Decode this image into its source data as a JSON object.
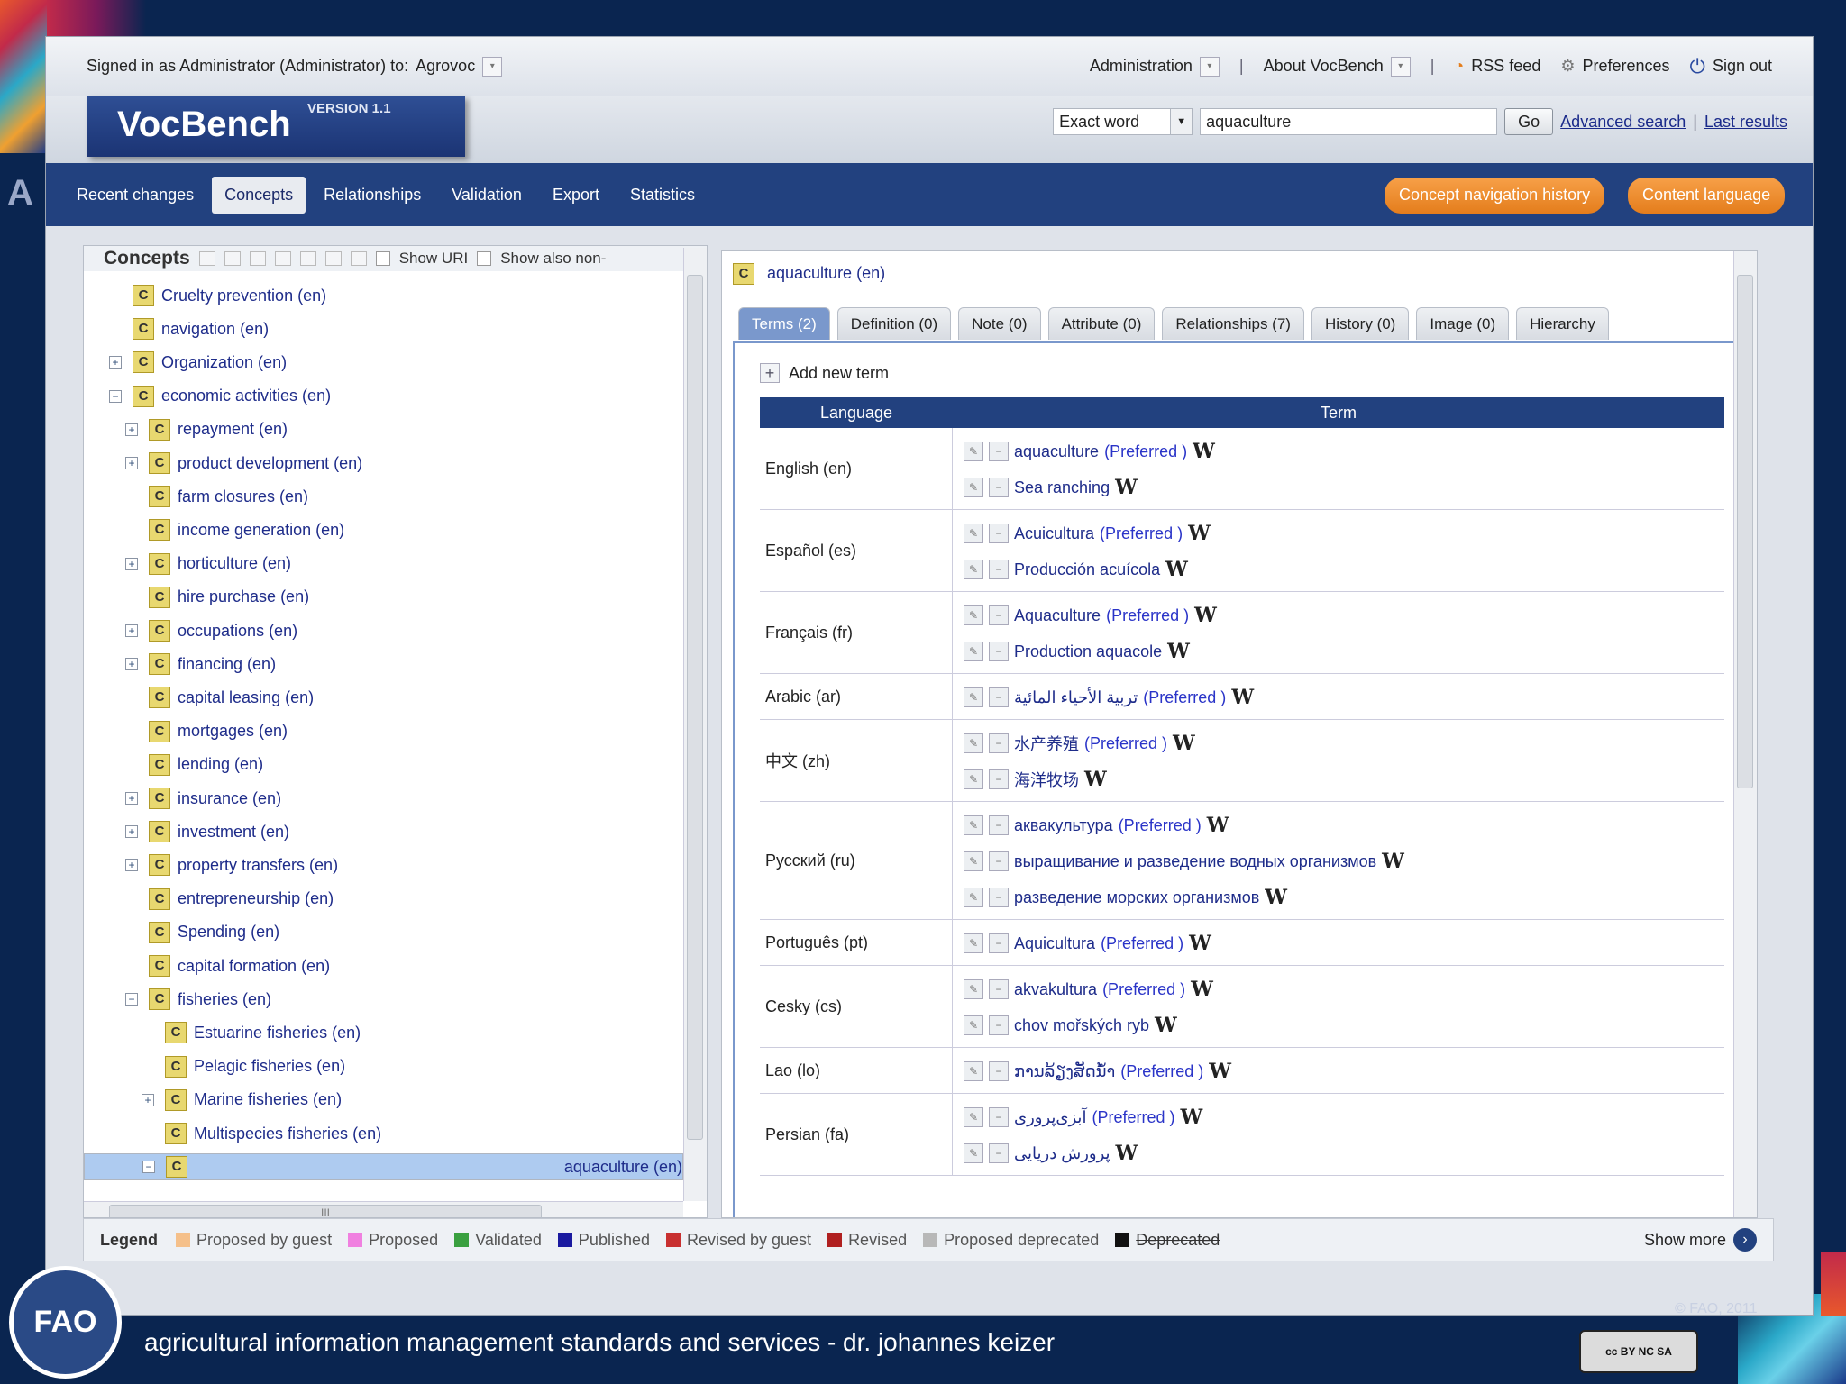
{
  "topbar": {
    "signed_in": "Signed in as Administrator (Administrator) to:",
    "project": "Agrovoc",
    "administration": "Administration",
    "about": "About VocBench",
    "rss": "RSS feed",
    "preferences": "Preferences",
    "signout": "Sign out"
  },
  "header": {
    "app_name": "VocBench",
    "version": "VERSION 1.1",
    "search_mode": "Exact word",
    "search_value": "aquaculture",
    "go": "Go",
    "advanced": "Advanced search",
    "last_results": "Last results"
  },
  "nav": {
    "tabs": [
      "Recent changes",
      "Concepts",
      "Relationships",
      "Validation",
      "Export",
      "Statistics"
    ],
    "active": "Concepts",
    "history_btn": "Concept navigation history",
    "language_btn": "Content language"
  },
  "concepts": {
    "title": "Concepts",
    "show_uri": "Show URI",
    "show_also": "Show also non-",
    "tree": [
      {
        "label": "Cruelty prevention (en)",
        "level": 0,
        "toggle": ""
      },
      {
        "label": "navigation (en)",
        "level": 0,
        "toggle": ""
      },
      {
        "label": "Organization (en)",
        "level": 0,
        "toggle": "+"
      },
      {
        "label": "economic activities (en)",
        "level": 0,
        "toggle": "-"
      },
      {
        "label": "repayment (en)",
        "level": 1,
        "toggle": "+"
      },
      {
        "label": "product development (en)",
        "level": 1,
        "toggle": "+"
      },
      {
        "label": "farm closures (en)",
        "level": 1,
        "toggle": ""
      },
      {
        "label": "income generation (en)",
        "level": 1,
        "toggle": ""
      },
      {
        "label": "horticulture (en)",
        "level": 1,
        "toggle": "+"
      },
      {
        "label": "hire purchase (en)",
        "level": 1,
        "toggle": ""
      },
      {
        "label": "occupations (en)",
        "level": 1,
        "toggle": "+"
      },
      {
        "label": "financing (en)",
        "level": 1,
        "toggle": "+"
      },
      {
        "label": "capital leasing (en)",
        "level": 1,
        "toggle": ""
      },
      {
        "label": "mortgages (en)",
        "level": 1,
        "toggle": ""
      },
      {
        "label": "lending (en)",
        "level": 1,
        "toggle": ""
      },
      {
        "label": "insurance (en)",
        "level": 1,
        "toggle": "+"
      },
      {
        "label": "investment (en)",
        "level": 1,
        "toggle": "+"
      },
      {
        "label": "property transfers (en)",
        "level": 1,
        "toggle": "+"
      },
      {
        "label": "entrepreneurship (en)",
        "level": 1,
        "toggle": ""
      },
      {
        "label": "Spending (en)",
        "level": 1,
        "toggle": ""
      },
      {
        "label": "capital formation (en)",
        "level": 1,
        "toggle": ""
      },
      {
        "label": "fisheries (en)",
        "level": 1,
        "toggle": "-"
      },
      {
        "label": "Estuarine fisheries (en)",
        "level": 2,
        "toggle": ""
      },
      {
        "label": "Pelagic fisheries (en)",
        "level": 2,
        "toggle": ""
      },
      {
        "label": "Marine fisheries (en)",
        "level": 2,
        "toggle": "+"
      },
      {
        "label": "Multispecies fisheries (en)",
        "level": 2,
        "toggle": ""
      },
      {
        "label": "aquaculture (en)",
        "level": 2,
        "toggle": "-",
        "selected": true
      }
    ]
  },
  "detail": {
    "title": "aquaculture (en)",
    "tabs": [
      "Terms (2)",
      "Definition (0)",
      "Note (0)",
      "Attribute (0)",
      "Relationships (7)",
      "History (0)",
      "Image (0)",
      "Hierarchy"
    ],
    "active_tab": "Terms (2)",
    "add_term": "Add new term",
    "col_language": "Language",
    "col_term": "Term",
    "preferred": "(Preferred )",
    "languages": [
      {
        "name": "English (en)",
        "terms": [
          {
            "t": "aquaculture",
            "pref": true
          },
          {
            "t": "Sea ranching",
            "pref": false
          }
        ]
      },
      {
        "name": "Español (es)",
        "terms": [
          {
            "t": "Acuicultura",
            "pref": true
          },
          {
            "t": "Producción acuícola",
            "pref": false
          }
        ]
      },
      {
        "name": "Français (fr)",
        "terms": [
          {
            "t": "Aquaculture",
            "pref": true
          },
          {
            "t": "Production aquacole",
            "pref": false
          }
        ]
      },
      {
        "name": "Arabic (ar)",
        "terms": [
          {
            "t": "تربية الأحياء المائية",
            "pref": true
          }
        ]
      },
      {
        "name": "中文 (zh)",
        "terms": [
          {
            "t": "水产养殖",
            "pref": true
          },
          {
            "t": "海洋牧场",
            "pref": false
          }
        ]
      },
      {
        "name": "Русский (ru)",
        "terms": [
          {
            "t": "аквакультура",
            "pref": true
          },
          {
            "t": "выращивание и разведение водных организмов",
            "pref": false
          },
          {
            "t": "разведение морских организмов",
            "pref": false
          }
        ]
      },
      {
        "name": "Português (pt)",
        "terms": [
          {
            "t": "Aquicultura",
            "pref": true
          }
        ]
      },
      {
        "name": "Cesky (cs)",
        "terms": [
          {
            "t": "akvakultura",
            "pref": true
          },
          {
            "t": "chov mořských ryb",
            "pref": false
          }
        ]
      },
      {
        "name": "Lao (lo)",
        "terms": [
          {
            "t": "ການລ້ຽງສັດນ້ຳ",
            "pref": true
          }
        ]
      },
      {
        "name": "Persian (fa)",
        "terms": [
          {
            "t": "آبزی‌پروری",
            "pref": true
          },
          {
            "t": "پرورش دریایی",
            "pref": false
          }
        ]
      }
    ]
  },
  "legend": {
    "title": "Legend",
    "items": [
      {
        "label": "Proposed by guest",
        "color": "#f5c08a"
      },
      {
        "label": "Proposed",
        "color": "#f080e0"
      },
      {
        "label": "Validated",
        "color": "#3aa040"
      },
      {
        "label": "Published",
        "color": "#1a1aa0"
      },
      {
        "label": "Revised by guest",
        "color": "#c83030"
      },
      {
        "label": "Revised",
        "color": "#b02020"
      },
      {
        "label": "Proposed deprecated",
        "color": "#b8b8b8"
      },
      {
        "label": "Deprecated",
        "color": "#111111"
      }
    ],
    "show_more": "Show more"
  },
  "footer": {
    "text": "agricultural information management standards and services  -   dr.   johannes keizer",
    "copyright": "© FAO, 2011",
    "fao": "FAO"
  },
  "colors": {
    "nav": "#22417f",
    "accent": "#e47d1c",
    "concept_icon": "#e8d870"
  }
}
